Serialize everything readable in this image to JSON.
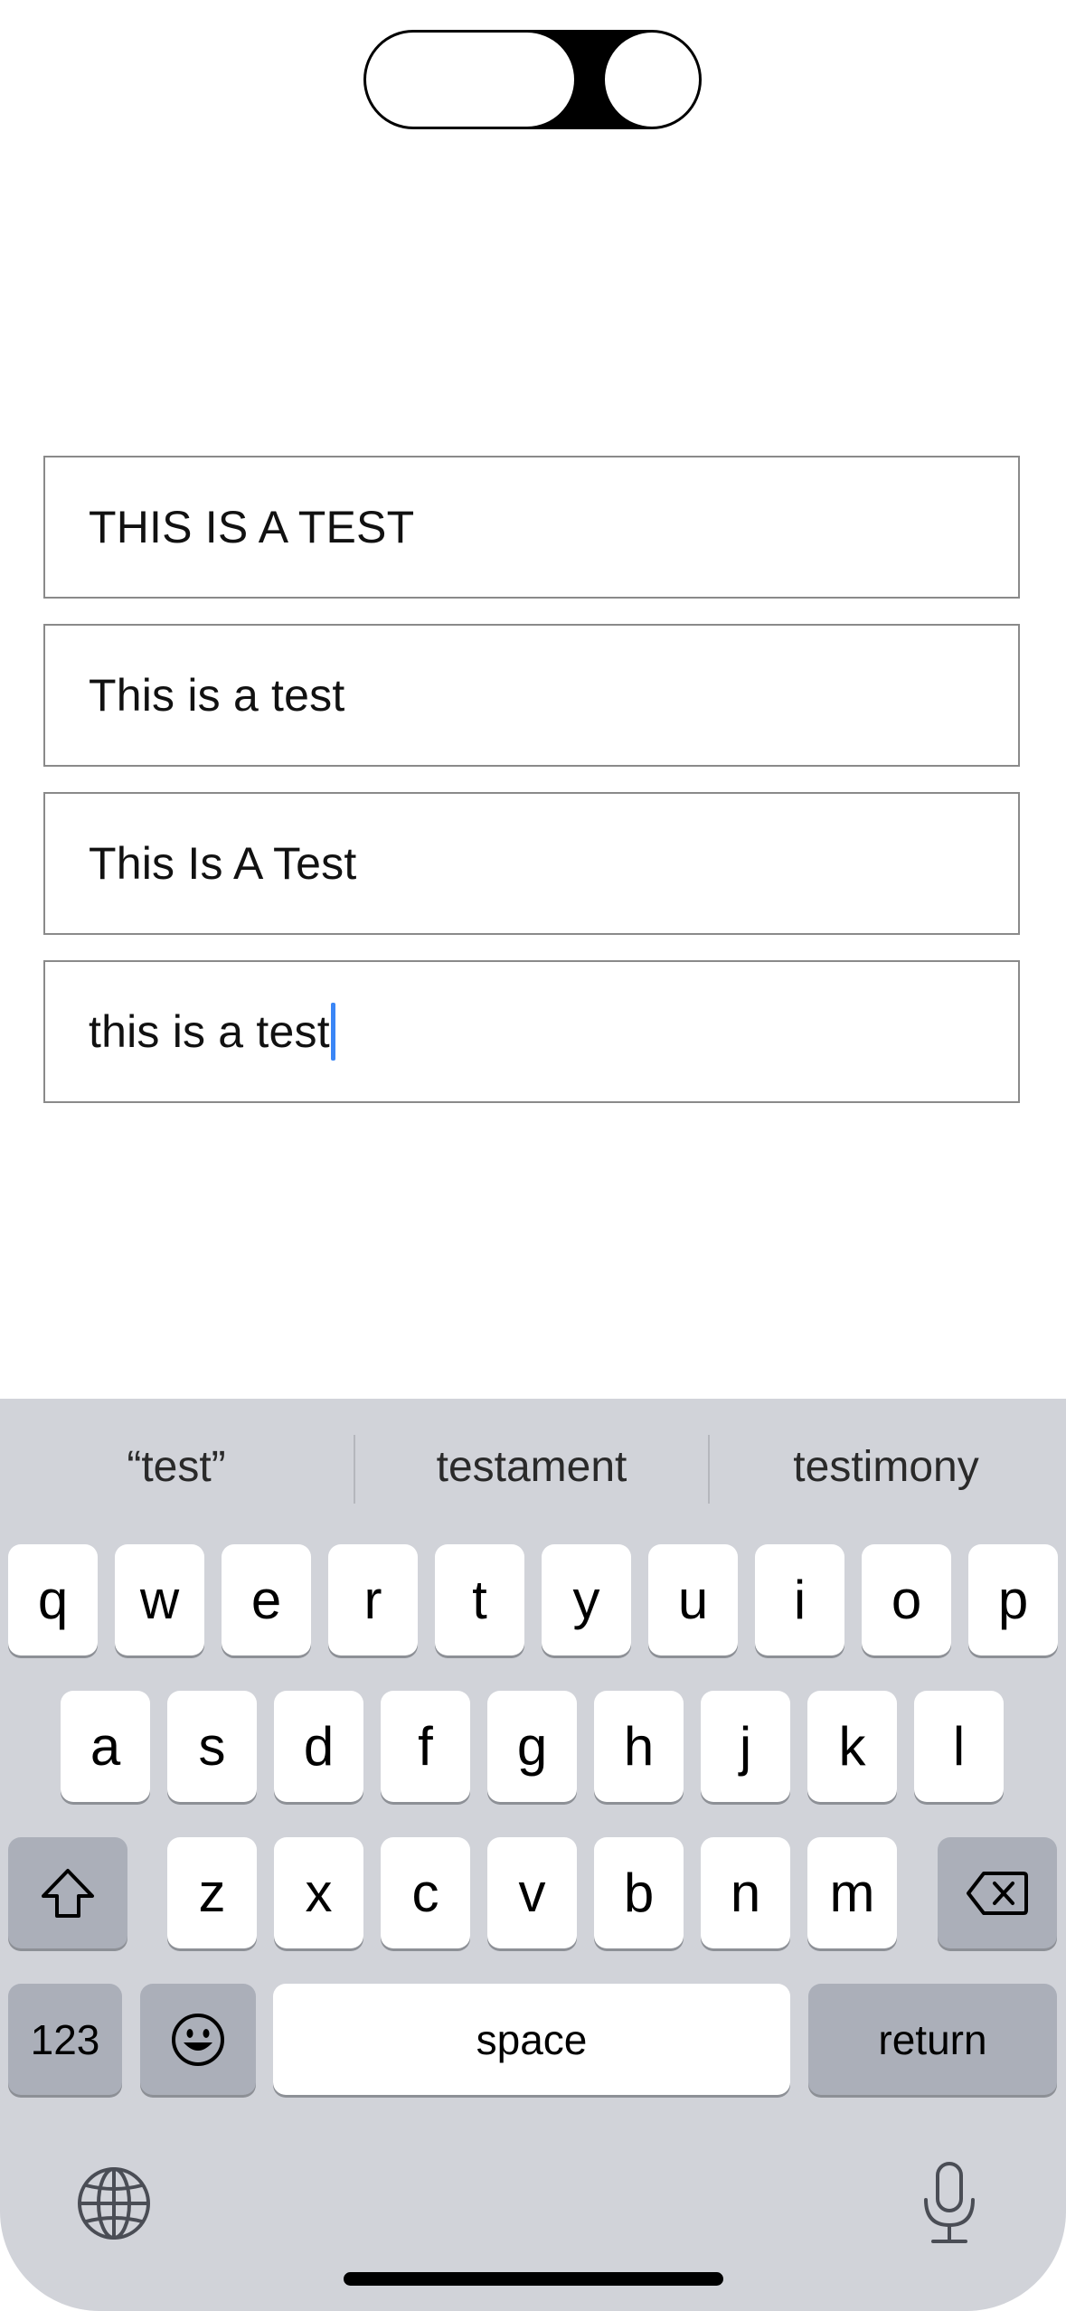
{
  "fields": [
    {
      "value": "THIS IS A TEST"
    },
    {
      "value": "This is a test"
    },
    {
      "value": "This Is A Test"
    },
    {
      "value": "this is a test"
    }
  ],
  "keyboard": {
    "suggestions": [
      "“test”",
      "testament",
      "testimony"
    ],
    "row1": [
      "q",
      "w",
      "e",
      "r",
      "t",
      "y",
      "u",
      "i",
      "o",
      "p"
    ],
    "row2": [
      "a",
      "s",
      "d",
      "f",
      "g",
      "h",
      "j",
      "k",
      "l"
    ],
    "row3": [
      "z",
      "x",
      "c",
      "v",
      "b",
      "n",
      "m"
    ],
    "numbers_label": "123",
    "space_label": "space",
    "return_label": "return",
    "icons": {
      "shift": "shift-icon",
      "delete": "delete-icon",
      "emoji": "emoji-icon",
      "globe": "globe-icon",
      "mic": "microphone-icon"
    }
  },
  "colors": {
    "keyboard_bg": "#d1d3d9",
    "key_bg": "#ffffff",
    "function_key_bg": "#abafb9",
    "caret": "#3a86f6"
  }
}
